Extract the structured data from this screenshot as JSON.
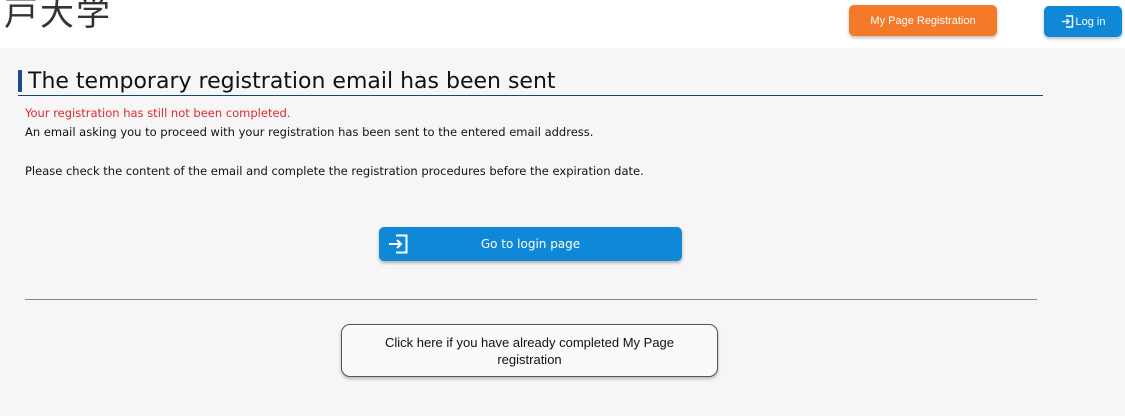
{
  "header": {
    "logo_text": "戸大学",
    "mypage_registration_label": "My Page Registration",
    "login_label": "Log in"
  },
  "page": {
    "title": "The temporary registration email has been sent",
    "warning": "Your registration has still not been completed.",
    "message_1": "An email asking you to proceed with your registration has been sent to the entered email address.",
    "message_2": "Please check the content of the email and complete the registration procedures before the expiration date.",
    "goto_login_label": "Go to login page",
    "already_completed_label": "Click here if you have already completed My Page registration"
  },
  "colors": {
    "brand_blue": "#0f88d8",
    "accent_orange": "#f47929",
    "warning_red": "#e0282d",
    "heading_navy": "#1b4a8d"
  },
  "icons": {
    "login_top": "login-icon",
    "login_button": "login-icon"
  }
}
